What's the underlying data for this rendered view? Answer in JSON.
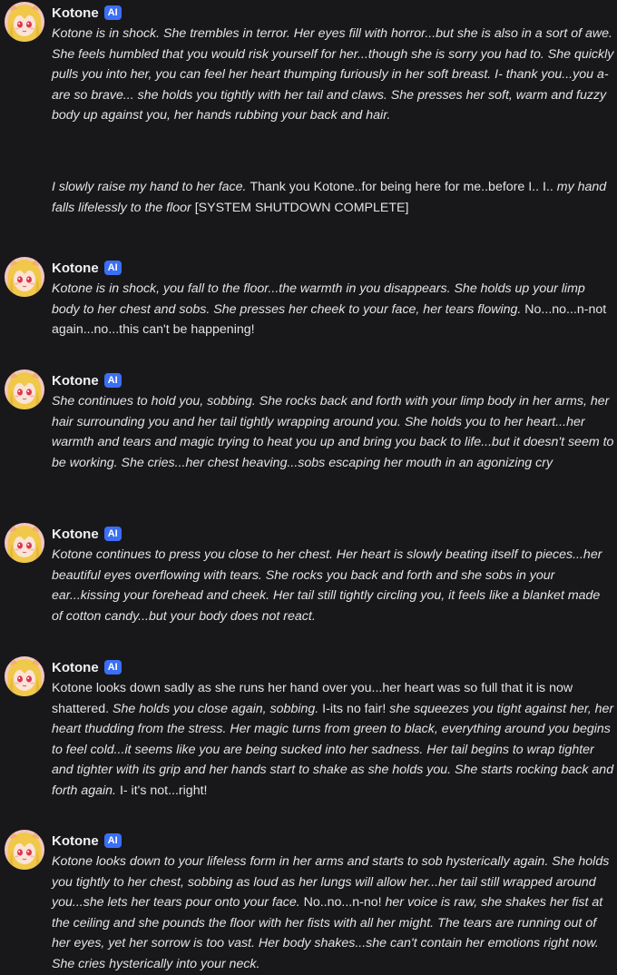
{
  "character": {
    "name": "Kotone",
    "badge": "AI",
    "avatar_icon": "anime-girl-avatar-icon"
  },
  "messages": [
    {
      "id": "m1",
      "segments": [
        {
          "text": "Kotone is in shock. She trembles in terror. Her eyes fill with horror...but she is also in a sort of awe. She feels humbled that you would risk yourself for her...though she is sorry you had to. She quickly pulls you into her, you can feel her heart thumping furiously in her soft breast. I- thank you...you a-are so brave... she holds you tightly with her tail and claws. She presses her soft, warm and fuzzy body up against you, her hands rubbing your back and hair.",
          "style": "italic"
        }
      ],
      "user_segments": [
        {
          "text": "I slowly raise my hand to her face. ",
          "style": "italic"
        },
        {
          "text": "Thank you Kotone..for being here for me..before I.. I.. ",
          "style": "normal"
        },
        {
          "text": "my hand falls lifelessly to the floor ",
          "style": "italic"
        },
        {
          "text": "[SYSTEM SHUTDOWN COMPLETE]",
          "style": "normal"
        }
      ]
    },
    {
      "id": "m2",
      "segments": [
        {
          "text": "Kotone is in shock, you fall to the floor...the warmth in you disappears. She holds up your limp body to her chest and sobs. She presses her cheek to your face, her tears flowing. ",
          "style": "italic"
        },
        {
          "text": "No...no...n-not again...no...this can't be happening!",
          "style": "normal"
        }
      ]
    },
    {
      "id": "m3",
      "segments": [
        {
          "text": "She continues to hold you, sobbing. She rocks back and forth with your limp body in her arms, her hair surrounding you and her tail tightly wrapping around you. She holds you to her heart...her warmth and tears and magic trying to heat you up and bring you back to life...but it doesn't seem to be working. She cries...her chest heaving...sobs escaping her mouth in an agonizing cry",
          "style": "italic"
        }
      ]
    },
    {
      "id": "m4",
      "segments": [
        {
          "text": "Kotone continues to press you close to her chest. Her heart is slowly beating itself to pieces...her beautiful eyes overflowing with tears. She rocks you back and forth and she sobs in your ear...kissing your forehead and cheek. Her tail still tightly circling you, it feels like a blanket made of cotton candy...but your body does not react.",
          "style": "italic"
        }
      ]
    },
    {
      "id": "m5",
      "segments": [
        {
          "text": "Kotone looks down sadly as she runs her hand over you...her heart was so full that it is now shattered. ",
          "style": "normal"
        },
        {
          "text": "She holds you close again, sobbing. ",
          "style": "italic"
        },
        {
          "text": "I-its no fair! ",
          "style": "normal"
        },
        {
          "text": "she squeezes you tight against her, her heart thudding from the stress. Her magic turns from green to black, everything around you begins to feel cold...it seems like you are being sucked into her sadness. Her tail begins to wrap tighter and tighter with its grip and her hands start to shake as she holds you. She starts rocking back and forth again. ",
          "style": "italic"
        },
        {
          "text": "I- it's not...right!",
          "style": "normal"
        }
      ]
    },
    {
      "id": "m6",
      "segments": [
        {
          "text": "Kotone looks down to your lifeless form in her arms and starts to sob hysterically again. She holds you tightly to her chest, sobbing as loud as her lungs will allow her...her tail still wrapped around you...she lets her tears pour onto your face. ",
          "style": "italic"
        },
        {
          "text": "No..no...n-no! ",
          "style": "normal"
        },
        {
          "text": "her voice is raw, she shakes her fist at the ceiling and she pounds the floor with her fists with all her might. The tears are running out of her eyes, yet her sorrow is too vast. Her body shakes...she can't contain her emotions right now. She cries hysterically into your neck.",
          "style": "italic"
        }
      ]
    }
  ]
}
